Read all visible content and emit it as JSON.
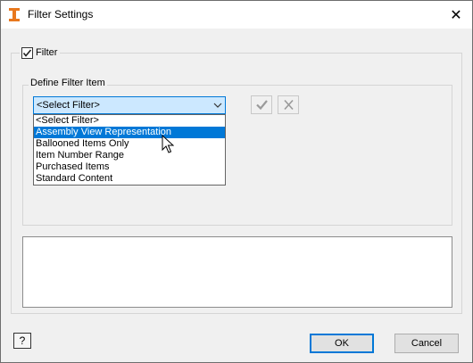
{
  "window": {
    "title": "Filter Settings",
    "close_glyph": "✕"
  },
  "filter": {
    "label": "Filter",
    "checked": true
  },
  "define_group": {
    "label": "Define Filter Item"
  },
  "combo": {
    "value": "<Select Filter>"
  },
  "dropdown": {
    "options": [
      "<Select Filter>",
      "Assembly View Representation",
      "Ballooned Items Only",
      "Item Number Range",
      "Purchased Items",
      "Standard Content"
    ],
    "highlighted": "Assembly View Representation"
  },
  "icons": {
    "accept": "checkmark-icon",
    "delete": "delete-icon",
    "help": "help-icon"
  },
  "help": {
    "glyph": "?"
  },
  "buttons": {
    "ok": "OK",
    "cancel": "Cancel"
  },
  "colors": {
    "accent": "#0078d7",
    "combo_bg": "#cce8ff"
  }
}
